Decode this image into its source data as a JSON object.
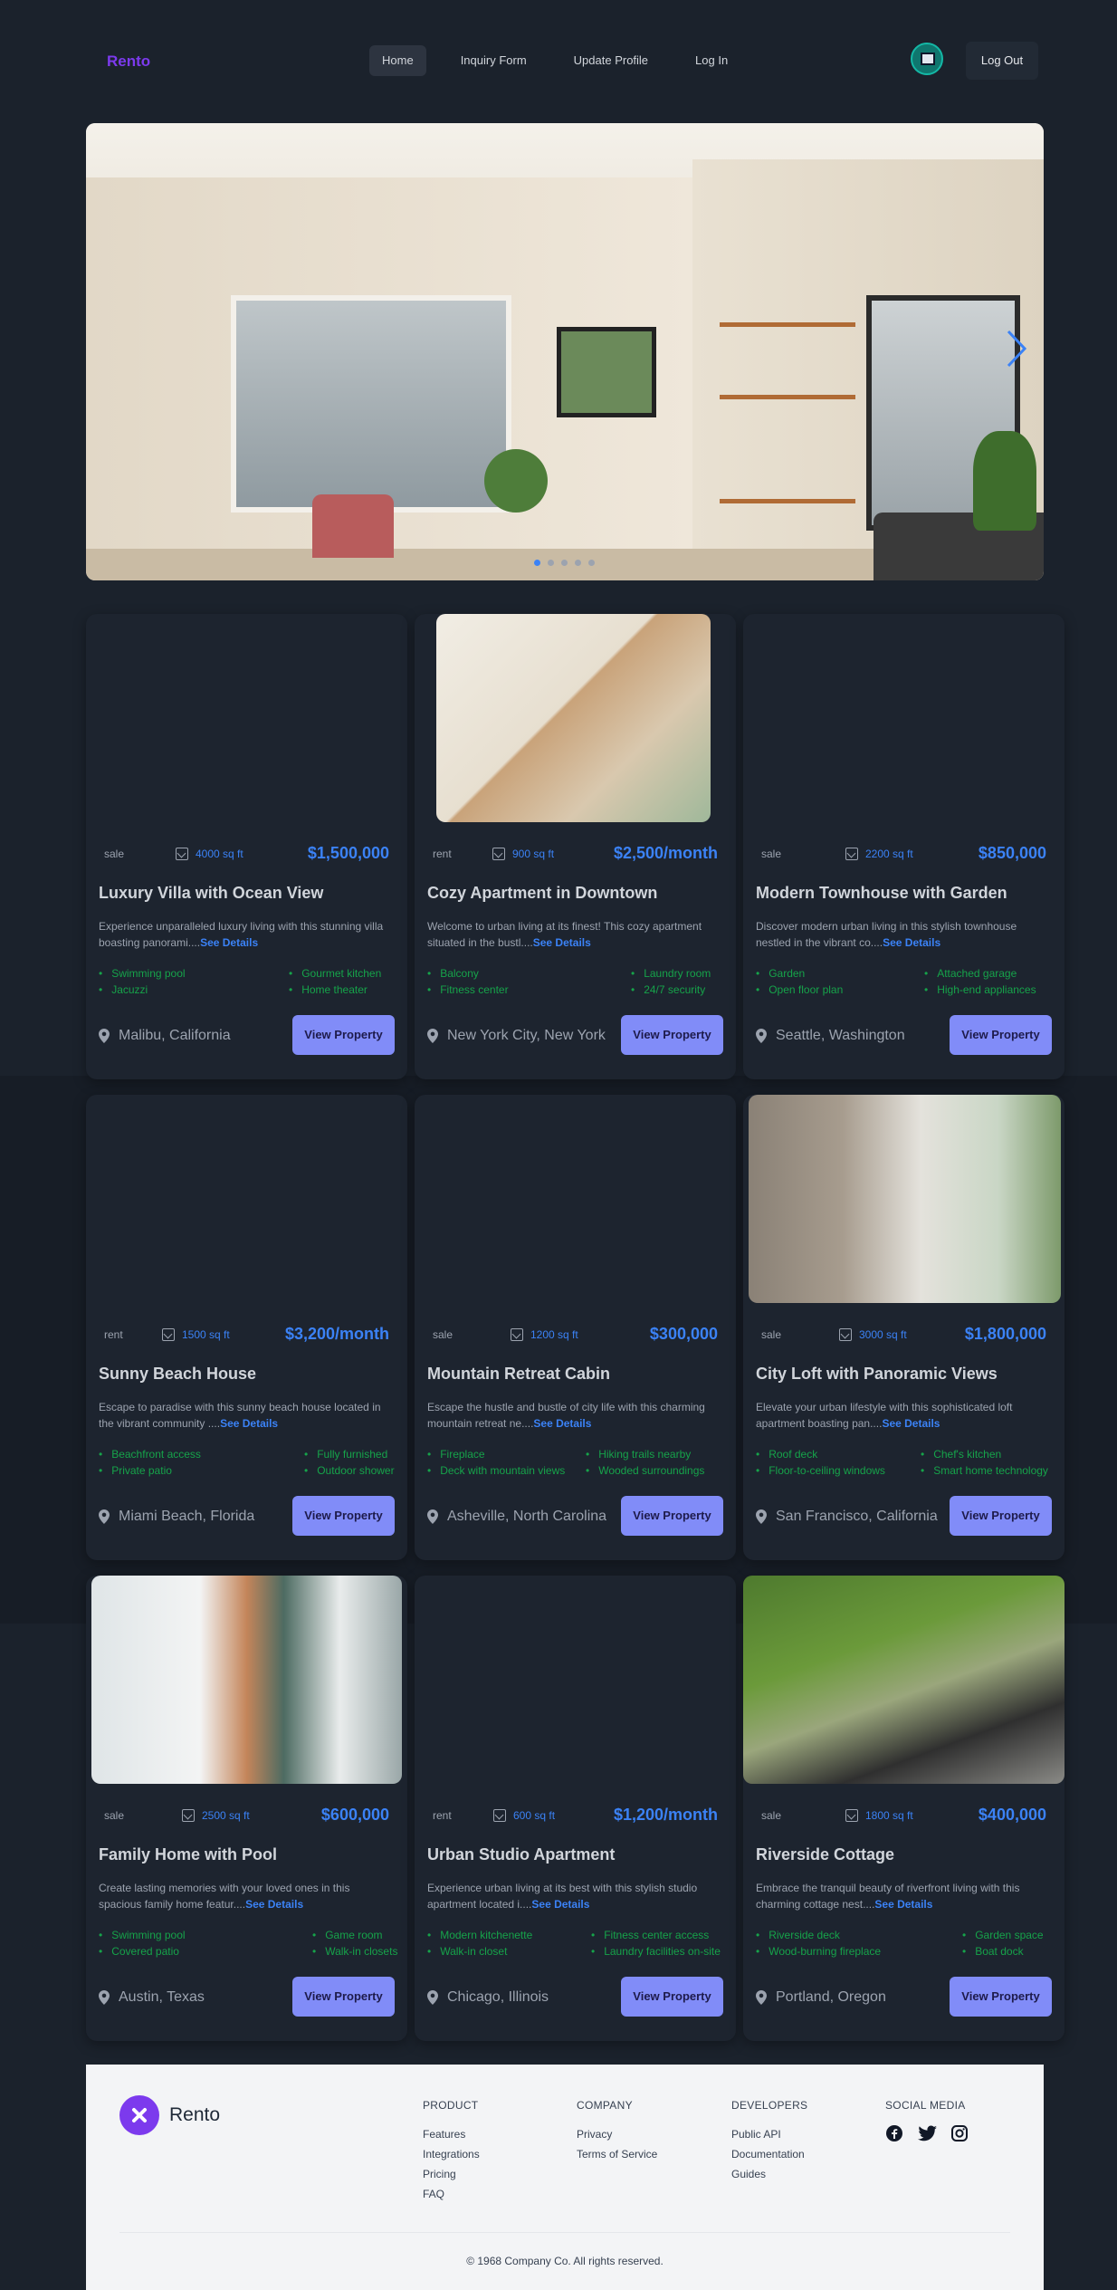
{
  "nav": {
    "logo": "Rento",
    "links": [
      {
        "label": "Home",
        "active": true
      },
      {
        "label": "Inquiry Form"
      },
      {
        "label": "Update Profile"
      },
      {
        "label": "Log In"
      }
    ],
    "logout_label": "Log Out",
    "avatar_icon": "monitor-icon"
  },
  "hero": {
    "slide_count": 5,
    "active_slide": 1,
    "next_icon": "chevron-right-icon"
  },
  "properties": [
    {
      "tag": "sale",
      "sqft": "4000 sq ft",
      "price": "$1,500,000",
      "title": "Luxury Villa with Ocean View",
      "desc": "Experience unparalleled luxury living with this stunning villa boasting panorami....",
      "more": "See Details",
      "features": [
        "Swimming pool",
        "Gourmet kitchen",
        "Jacuzzi",
        "Home theater"
      ],
      "location": "Malibu, California",
      "button": "View Property",
      "photo": false
    },
    {
      "tag": "rent",
      "sqft": "900 sq ft",
      "price": "$2,500/month",
      "title": "Cozy Apartment in Downtown",
      "desc": "Welcome to urban living at its finest! This cozy apartment situated in the bustl....",
      "more": "See Details",
      "features": [
        "Balcony",
        "Laundry room",
        "Fitness center",
        "24/7 security"
      ],
      "location": "New York City, New York",
      "button": "View Property",
      "photo": true
    },
    {
      "tag": "sale",
      "sqft": "2200 sq ft",
      "price": "$850,000",
      "title": "Modern Townhouse with Garden",
      "desc": "Discover modern urban living in this stylish townhouse nestled in the vibrant co....",
      "more": "See Details",
      "features": [
        "Garden",
        "Attached garage",
        "Open floor plan",
        "High-end appliances"
      ],
      "location": "Seattle, Washington",
      "button": "View Property",
      "photo": false
    },
    {
      "tag": "rent",
      "sqft": "1500 sq ft",
      "price": "$3,200/month",
      "title": "Sunny Beach House",
      "desc": "Escape to paradise with this sunny beach house located in the vibrant community ....",
      "more": "See Details",
      "features": [
        "Beachfront access",
        "Fully furnished",
        "Private patio",
        "Outdoor shower"
      ],
      "location": "Miami Beach, Florida",
      "button": "View Property",
      "photo": false
    },
    {
      "tag": "sale",
      "sqft": "1200 sq ft",
      "price": "$300,000",
      "title": "Mountain Retreat Cabin",
      "desc": "Escape the hustle and bustle of city life with this charming mountain retreat ne....",
      "more": "See Details",
      "features": [
        "Fireplace",
        "Hiking trails nearby",
        "Deck with mountain views",
        "Wooded surroundings"
      ],
      "location": "Asheville, North Carolina",
      "button": "View Property",
      "photo": false
    },
    {
      "tag": "sale",
      "sqft": "3000 sq ft",
      "price": "$1,800,000",
      "title": "City Loft with Panoramic Views",
      "desc": "Elevate your urban lifestyle with this sophisticated loft apartment boasting pan....",
      "more": "See Details",
      "features": [
        "Roof deck",
        "Chef's kitchen",
        "Floor-to-ceiling windows",
        "Smart home technology"
      ],
      "location": "San Francisco, California",
      "button": "View Property",
      "photo": true
    },
    {
      "tag": "sale",
      "sqft": "2500 sq ft",
      "price": "$600,000",
      "title": "Family Home with Pool",
      "desc": "Create lasting memories with your loved ones in this spacious family home featur....",
      "more": "See Details",
      "features": [
        "Swimming pool",
        "Game room",
        "Covered patio",
        "Walk-in closets"
      ],
      "location": "Austin, Texas",
      "button": "View Property",
      "photo": true
    },
    {
      "tag": "rent",
      "sqft": "600 sq ft",
      "price": "$1,200/month",
      "title": "Urban Studio Apartment",
      "desc": "Experience urban living at its best with this stylish studio apartment located i....",
      "more": "See Details",
      "features": [
        "Modern kitchenette",
        "Fitness center access",
        "Walk-in closet",
        "Laundry facilities on-site"
      ],
      "location": "Chicago, Illinois",
      "button": "View Property",
      "photo": false
    },
    {
      "tag": "sale",
      "sqft": "1800 sq ft",
      "price": "$400,000",
      "title": "Riverside Cottage",
      "desc": "Embrace the tranquil beauty of riverfront living with this charming cottage nest....",
      "more": "See Details",
      "features": [
        "Riverside deck",
        "Garden space",
        "Wood-burning fireplace",
        "Boat dock"
      ],
      "location": "Portland, Oregon",
      "button": "View Property",
      "photo": true
    }
  ],
  "footer": {
    "brand": "Rento",
    "columns": [
      {
        "heading": "PRODUCT",
        "links": [
          "Features",
          "Integrations",
          "Pricing",
          "FAQ"
        ]
      },
      {
        "heading": "COMPANY",
        "links": [
          "Privacy",
          "Terms of Service"
        ]
      },
      {
        "heading": "DEVELOPERS",
        "links": [
          "Public API",
          "Documentation",
          "Guides"
        ]
      },
      {
        "heading": "SOCIAL MEDIA",
        "icons": [
          "facebook-icon",
          "twitter-icon",
          "instagram-icon"
        ]
      }
    ],
    "copyright": "© 1968 Company Co. All rights reserved."
  },
  "colors": {
    "background": "#1b222c",
    "accent": "#3b82f6",
    "button": "#818cf8",
    "feature": "#16a34a",
    "brand": "#7c3aed"
  }
}
